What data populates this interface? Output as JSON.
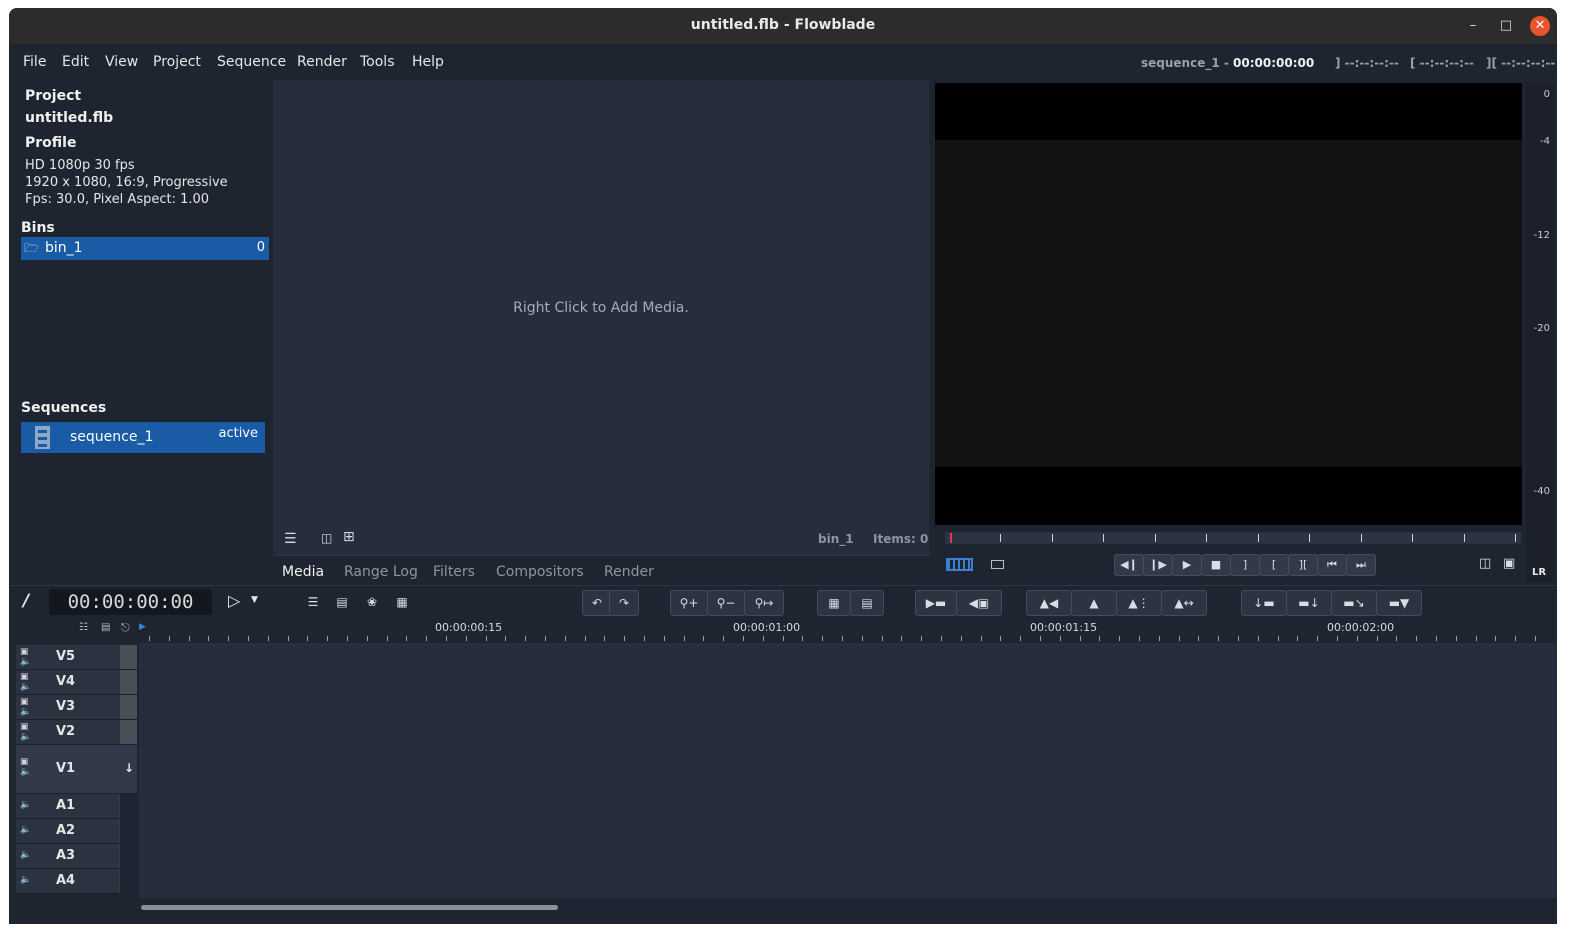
{
  "window": {
    "title": "untitled.flb - Flowblade",
    "minimize": "–",
    "maximize": "□",
    "close": "✕"
  },
  "menu": [
    "File",
    "Edit",
    "View",
    "Project",
    "Sequence",
    "Render",
    "Tools",
    "Help"
  ],
  "timecode_header": {
    "sequence": "sequence_1 -",
    "time": "00:00:00:00",
    "mark_in": "] --:--:--:--",
    "mark_out": "[ --:--:--:--",
    "length": "][ --:--:--:--"
  },
  "project": {
    "heading": "Project",
    "name": "untitled.flb",
    "profile_heading": "Profile",
    "profile_name": "HD 1080p 30 fps",
    "profile_size": "1920 x 1080, 16:9, Progressive",
    "profile_fps": "Fps: 30.0, Pixel Aspect: 1.00"
  },
  "bins": {
    "heading": "Bins",
    "items": [
      {
        "name": "bin_1",
        "count": "0"
      }
    ]
  },
  "sequences": {
    "heading": "Sequences",
    "items": [
      {
        "name": "sequence_1",
        "status": "active"
      }
    ]
  },
  "media": {
    "hint": "Right Click to Add Media.",
    "bin_name": "bin_1",
    "items_label": "Items: 0"
  },
  "tabs": [
    "Media",
    "Range Log",
    "Filters",
    "Compositors",
    "Render"
  ],
  "meter": {
    "labels": [
      "0",
      "-4",
      "-12",
      "-20",
      "-40"
    ],
    "channels": "LR"
  },
  "timeline": {
    "timecode": "00:00:00:00",
    "ruler_labels": [
      "00:00:00:15",
      "00:00:01:00",
      "00:00:01:15",
      "00:00:02:00"
    ],
    "video_tracks": [
      "V5",
      "V4",
      "V3",
      "V2",
      "V1"
    ],
    "audio_tracks": [
      "A1",
      "A2",
      "A3",
      "A4"
    ]
  },
  "colors": {
    "background": "#1e2430",
    "selection": "#1a5ba5",
    "accent_close": "#e9542c"
  }
}
